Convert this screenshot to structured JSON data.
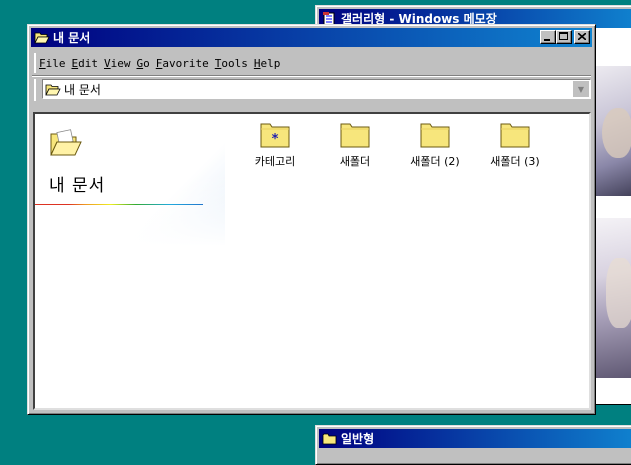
{
  "background_windows": {
    "notepad_title": "갤러리형 - Windows 메모장",
    "general_title": "일반형"
  },
  "window": {
    "title": "내 문서",
    "buttons": {
      "minimize": "minimize",
      "maximize": "maximize",
      "close": "close"
    }
  },
  "menu": [
    {
      "key": "F",
      "rest": "ile"
    },
    {
      "key": "E",
      "rest": "dit"
    },
    {
      "key": "V",
      "rest": "iew"
    },
    {
      "key": "G",
      "rest": "o"
    },
    {
      "key": "F",
      "rest": "avorite"
    },
    {
      "key": "T",
      "rest": "ools"
    },
    {
      "key": "H",
      "rest": "elp"
    }
  ],
  "address": {
    "value": "내 문서"
  },
  "sidebar": {
    "title": "내 문서"
  },
  "items": [
    {
      "label": "카테고리",
      "icon": "special-folder-icon"
    },
    {
      "label": "새폴더",
      "icon": "folder-icon"
    },
    {
      "label": "새폴더 (2)",
      "icon": "folder-icon"
    },
    {
      "label": "새폴더 (3)",
      "icon": "folder-icon"
    }
  ],
  "colors": {
    "desktop": "#008080",
    "titlebar_start": "#000080",
    "titlebar_end": "#1084d0",
    "folder": "#f7e67c"
  }
}
